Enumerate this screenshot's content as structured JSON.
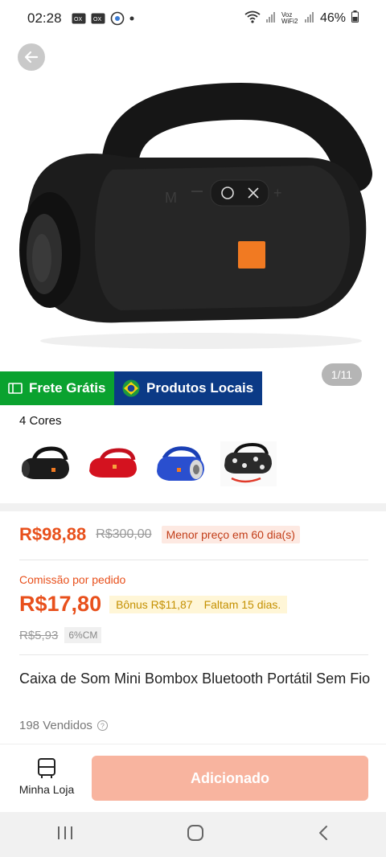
{
  "status_bar": {
    "time": "02:28",
    "network_label": "Voz WiFi2",
    "battery": "46%"
  },
  "gallery": {
    "counter": "1/11"
  },
  "badges": {
    "free_shipping": "Frete Grátis",
    "local_products": "Produtos Locais"
  },
  "colors": {
    "label": "4 Cores",
    "options": [
      "black",
      "red",
      "blue",
      "pattern"
    ]
  },
  "pricing": {
    "current": "R$98,88",
    "old": "R$300,00",
    "lowest_tag": "Menor preço em 60 dia(s)"
  },
  "commission": {
    "label": "Comissão por pedido",
    "value": "R$17,80",
    "bonus": "Bônus R$11,87",
    "remaining": "Faltam 15 dias.",
    "old": "R$5,93",
    "rate": "6%CM"
  },
  "product": {
    "title": "Caixa de Som Mini Bombox Bluetooth Portátil Sem Fio",
    "sold": "198 Vendidos"
  },
  "bottom": {
    "store_label": "Minha Loja",
    "add_label": "Adicionado"
  },
  "palette": {
    "accent": "#e8501c",
    "green": "#0aa22f",
    "navy": "#0b3a86"
  }
}
